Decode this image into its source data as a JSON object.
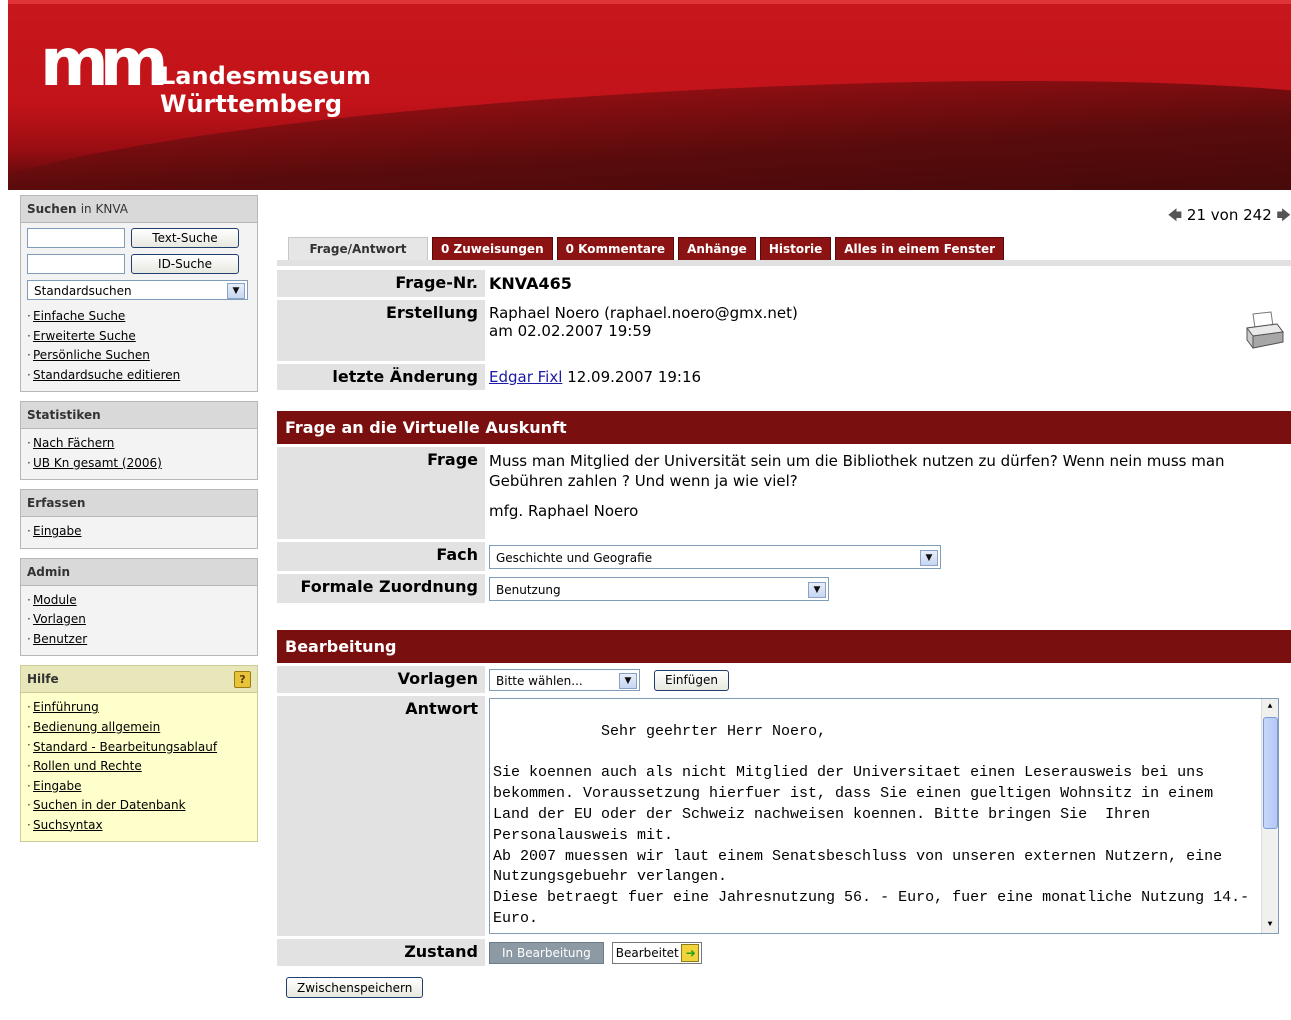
{
  "header": {
    "logo_mark": "m",
    "logo_line1": "Landesmuseum",
    "logo_line2": "Württemberg"
  },
  "sidebar": {
    "search": {
      "title": "Suchen",
      "title_suffix": "in KNVA",
      "text_search_label": "Text-Suche",
      "id_search_label": "ID-Suche",
      "select_value": "Standardsuchen",
      "links": [
        "Einfache Suche",
        "Erweiterte Suche",
        "Persönliche Suchen",
        "Standardsuche editieren"
      ]
    },
    "statistiken": {
      "title": "Statistiken",
      "links": [
        "Nach Fächern",
        "UB Kn gesamt (2006)"
      ]
    },
    "erfassen": {
      "title": "Erfassen",
      "links": [
        "Eingabe"
      ]
    },
    "admin": {
      "title": "Admin",
      "links": [
        "Module",
        "Vorlagen",
        "Benutzer"
      ]
    },
    "hilfe": {
      "title": "Hilfe",
      "icon": "?",
      "links": [
        "Einführung",
        "Bedienung allgemein",
        "Standard - Bearbeitungsablauf",
        "Rollen und Rechte",
        "Eingabe",
        "Suchen in der Datenbank",
        "Suchsyntax"
      ]
    }
  },
  "pager": {
    "text": "21 von 242"
  },
  "tabs": [
    "Frage/Antwort",
    "0 Zuweisungen",
    "0 Kommentare",
    "Anhänge",
    "Historie",
    "Alles in einem Fenster"
  ],
  "record": {
    "frage_nr_label": "Frage-Nr.",
    "frage_nr": "KNVA465",
    "erstellung_label": "Erstellung",
    "erstellung_line1": "Raphael Noero (raphael.noero@gmx.net)",
    "erstellung_line2": "am 02.02.2007 19:59",
    "aenderung_label": "letzte Änderung",
    "aenderung_user": "Edgar Fixl",
    "aenderung_date": "12.09.2007 19:16"
  },
  "section1": {
    "title": "Frage an die Virtuelle Auskunft",
    "frage_label": "Frage",
    "frage_text": "Muss man Mitglied der Universität sein um die Bibliothek nutzen zu dürfen? Wenn nein muss man Gebühren zahlen ? Und wenn ja wie viel?",
    "frage_sign": "mfg. Raphael Noero",
    "fach_label": "Fach",
    "fach_value": "Geschichte und Geografie",
    "zuordnung_label": "Formale Zuordnung",
    "zuordnung_value": "Benutzung"
  },
  "section2": {
    "title": "Bearbeitung",
    "vorlagen_label": "Vorlagen",
    "vorlagen_value": "Bitte wählen...",
    "einfuegen_label": "Einfügen",
    "antwort_label": "Antwort",
    "antwort_text": "Sehr geehrter Herr Noero,\n\nSie koennen auch als nicht Mitglied der Universitaet einen Leserausweis bei uns bekommen. Voraussetzung hierfuer ist, dass Sie einen gueltigen Wohnsitz in einem Land der EU oder der Schweiz nachweisen koennen. Bitte bringen Sie  Ihren Personalausweis mit.\nAb 2007 muessen wir laut einem Senatsbeschluss von unseren externen Nutzern, eine Nutzungsgebuehr verlangen.\nDiese betraegt fuer eine Jahresnutzung 56. - Euro, fuer eine monatliche Nutzung 14.- Euro.",
    "zustand_label": "Zustand",
    "zustand_in": "In Bearbeitung",
    "zustand_done": "Bearbeitet",
    "save_label": "Zwischenspeichern"
  }
}
